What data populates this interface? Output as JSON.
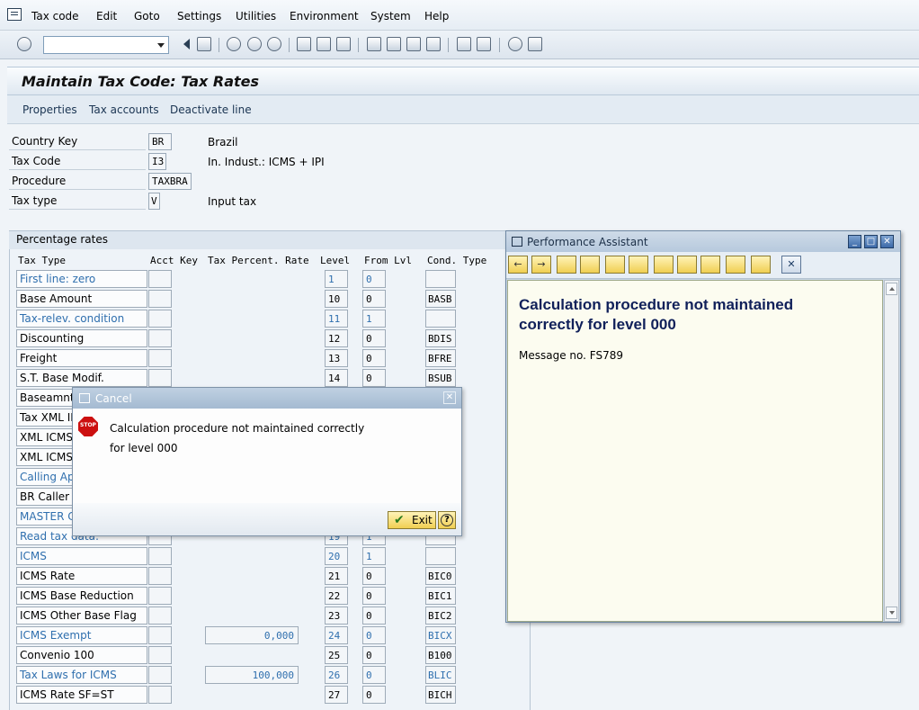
{
  "menu": [
    "Tax code",
    "Edit",
    "Goto",
    "Settings",
    "Utilities",
    "Environment",
    "System",
    "Help"
  ],
  "page_title": "Maintain Tax Code: Tax Rates",
  "app_toolbar": [
    "Properties",
    "Tax accounts",
    "Deactivate line"
  ],
  "header": [
    {
      "label": "Country Key",
      "value": "BR",
      "desc": "Brazil"
    },
    {
      "label": "Tax Code",
      "value": "I3",
      "desc": "In. Indust.: ICMS + IPI"
    },
    {
      "label": "Procedure",
      "value": "TAXBRA",
      "desc": ""
    },
    {
      "label": "Tax type",
      "value": "V",
      "desc": "Input tax"
    }
  ],
  "group_title": "Percentage rates",
  "columns": {
    "tax_type": "Tax Type",
    "acct_key": "Acct Key",
    "rate": "Tax Percent. Rate",
    "level": "Level",
    "from_lvl": "From Lvl",
    "cond_type": "Cond. Type"
  },
  "rows": [
    {
      "label": "First line: zero",
      "level": "1",
      "from": "0",
      "cond": "",
      "rate": "",
      "blue": true
    },
    {
      "label": "Base Amount",
      "level": "10",
      "from": "0",
      "cond": "BASB",
      "rate": "",
      "blue": false
    },
    {
      "label": "Tax-relev. condition",
      "level": "11",
      "from": "1",
      "cond": "",
      "rate": "",
      "blue": true
    },
    {
      "label": "Discounting",
      "level": "12",
      "from": "0",
      "cond": "BDIS",
      "rate": "",
      "blue": false
    },
    {
      "label": "Freight",
      "level": "13",
      "from": "0",
      "cond": "BFRE",
      "rate": "",
      "blue": false
    },
    {
      "label": "S.T. Base Modif.",
      "level": "14",
      "from": "0",
      "cond": "BSUB",
      "rate": "",
      "blue": false
    },
    {
      "label": "Baseamnt X",
      "level": "",
      "from": "",
      "cond": "",
      "rate": "",
      "blue": false
    },
    {
      "label": "Tax XML IP",
      "level": "",
      "from": "",
      "cond": "",
      "rate": "",
      "blue": false
    },
    {
      "label": "XML ICMS",
      "level": "",
      "from": "",
      "cond": "",
      "rate": "",
      "blue": false
    },
    {
      "label": "XML ICMS",
      "level": "",
      "from": "",
      "cond": "",
      "rate": "",
      "blue": false
    },
    {
      "label": "Calling App",
      "level": "",
      "from": "",
      "cond": "",
      "rate": "",
      "blue": true
    },
    {
      "label": "BR Caller =",
      "level": "",
      "from": "",
      "cond": "",
      "rate": "",
      "blue": false
    },
    {
      "label": "MASTER CO",
      "level": "",
      "from": "",
      "cond": "",
      "rate": "",
      "blue": true
    },
    {
      "label": "Read tax data:",
      "level": "19",
      "from": "1",
      "cond": "",
      "rate": "",
      "blue": true
    },
    {
      "label": "ICMS",
      "level": "20",
      "from": "1",
      "cond": "",
      "rate": "",
      "blue": true
    },
    {
      "label": "ICMS Rate",
      "level": "21",
      "from": "0",
      "cond": "BIC0",
      "rate": "",
      "blue": false
    },
    {
      "label": "ICMS Base Reduction",
      "level": "22",
      "from": "0",
      "cond": "BIC1",
      "rate": "",
      "blue": false
    },
    {
      "label": "ICMS Other Base Flag",
      "level": "23",
      "from": "0",
      "cond": "BIC2",
      "rate": "",
      "blue": false
    },
    {
      "label": "ICMS Exempt",
      "level": "24",
      "from": "0",
      "cond": "BICX",
      "rate": "0,000",
      "blue": true
    },
    {
      "label": "Convenio 100",
      "level": "25",
      "from": "0",
      "cond": "B100",
      "rate": "",
      "blue": false
    },
    {
      "label": "Tax Laws for ICMS",
      "level": "26",
      "from": "0",
      "cond": "BLIC",
      "rate": "100,000",
      "blue": true
    },
    {
      "label": "ICMS Rate SF=ST",
      "level": "27",
      "from": "0",
      "cond": "BICH",
      "rate": "",
      "blue": false
    }
  ],
  "cancel_dialog": {
    "title": "Cancel",
    "stop_label": "STOP",
    "message": "Calculation procedure not maintained correctly for level 000",
    "exit_label": "Exit",
    "close_glyph": "✕",
    "help_glyph": "?",
    "icons": [
      "stop-icon",
      "checkmark-icon",
      "help-icon"
    ]
  },
  "performance_assistant": {
    "title": "Performance Assistant",
    "heading": "Calculation procedure not maintained correctly for level 000",
    "message_no": "Message no. FS789"
  }
}
